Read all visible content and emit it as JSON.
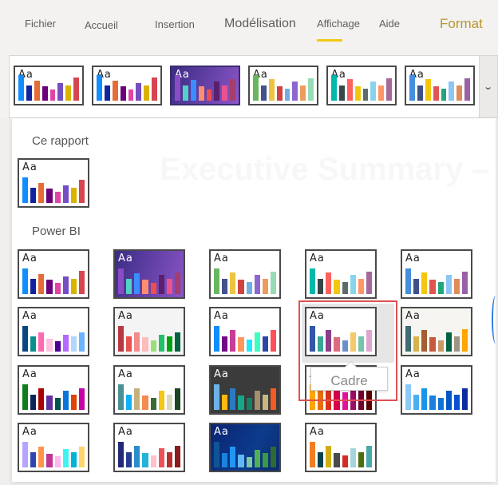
{
  "ribbon": {
    "tabs": [
      {
        "label": "Fichier"
      },
      {
        "label": "Accueil"
      },
      {
        "label": "Insertion"
      },
      {
        "label": "Modélisation"
      },
      {
        "label": "Affichage",
        "active": true
      },
      {
        "label": "Aide"
      },
      {
        "label": "Format",
        "contextual": true
      }
    ],
    "active_color": "#f2c811",
    "contextual_color": "#b8962e"
  },
  "thumb_label": "Aa",
  "gallery_expand_icon": "chevron-down-icon",
  "background_doc": {
    "title": "Executive Summary – Finance Report"
  },
  "sections": {
    "this_report": "Ce rapport",
    "power_bi": "Power BI"
  },
  "tooltip": "Cadre",
  "strip_themes": [
    {
      "bg": "#ffffff",
      "colors": [
        "#118dff",
        "#12239e",
        "#e66c37",
        "#6b007b",
        "#e044a7",
        "#744ec2",
        "#d9b300",
        "#d64550"
      ],
      "heights": [
        1,
        0.58,
        0.78,
        0.55,
        0.45,
        0.7,
        0.6,
        0.9
      ]
    },
    {
      "bg": "#ffffff",
      "colors": [
        "#118dff",
        "#12239e",
        "#e66c37",
        "#6b007b",
        "#e044a7",
        "#744ec2",
        "#d9b300",
        "#d64550"
      ],
      "heights": [
        1,
        0.58,
        0.78,
        0.55,
        0.45,
        0.7,
        0.6,
        0.9
      ]
    },
    {
      "bg": "linear-gradient(110deg,#3a2c84,#8c55c8)",
      "dark": true,
      "selected": true,
      "colors": [
        "#8a4cc4",
        "#52d1c5",
        "#3b8cff",
        "#ff8e6e",
        "#ee4d4d",
        "#5a1f6e",
        "#e9528d",
        "#a43e6e"
      ],
      "heights": [
        1,
        0.58,
        0.82,
        0.55,
        0.45,
        0.75,
        0.58,
        0.85
      ]
    },
    {
      "bg": "#ffffff",
      "colors": [
        "#6ab660",
        "#43518c",
        "#ecc440",
        "#cf4340",
        "#72aee3",
        "#8d67d0",
        "#ee9c5c",
        "#96dcb5"
      ],
      "heights": [
        1,
        0.58,
        0.85,
        0.55,
        0.48,
        0.75,
        0.58,
        0.88
      ]
    },
    {
      "bg": "#ffffff",
      "colors": [
        "#01b8aa",
        "#374649",
        "#fd625e",
        "#f2c80f",
        "#5f6b6d",
        "#8ad4eb",
        "#fe9666",
        "#a66999"
      ],
      "heights": [
        1,
        0.6,
        0.85,
        0.55,
        0.48,
        0.75,
        0.58,
        0.88
      ]
    },
    {
      "bg": "#ffffff",
      "colors": [
        "#468ede",
        "#3f5189",
        "#f4c70f",
        "#e05552",
        "#21a57a",
        "#8dc6f4",
        "#df8b5a",
        "#9a62a6"
      ],
      "heights": [
        1,
        0.6,
        0.85,
        0.55,
        0.48,
        0.75,
        0.58,
        0.88
      ]
    }
  ],
  "this_report_theme": {
    "bg": "#ffffff",
    "colors": [
      "#118dff",
      "#12239e",
      "#e66c37",
      "#6b007b",
      "#e044a7",
      "#744ec2",
      "#d9b300",
      "#d64550"
    ],
    "heights": [
      1,
      0.58,
      0.78,
      0.55,
      0.45,
      0.7,
      0.6,
      0.9
    ]
  },
  "power_bi_themes": [
    {
      "bg": "#ffffff",
      "colors": [
        "#118dff",
        "#12239e",
        "#e66c37",
        "#6b007b",
        "#e044a7",
        "#744ec2",
        "#d9b300",
        "#d64550"
      ],
      "heights": [
        1,
        0.58,
        0.78,
        0.55,
        0.45,
        0.7,
        0.6,
        0.9
      ]
    },
    {
      "bg": "linear-gradient(110deg,#3a2c84,#8c55c8)",
      "dark": true,
      "colors": [
        "#8a4cc4",
        "#52d1c5",
        "#3b8cff",
        "#ff8e6e",
        "#ee4d4d",
        "#5a1f6e",
        "#e9528d",
        "#a43e6e"
      ],
      "heights": [
        1,
        0.58,
        0.82,
        0.55,
        0.45,
        0.75,
        0.58,
        0.85
      ]
    },
    {
      "bg": "#ffffff",
      "colors": [
        "#6ab660",
        "#43518c",
        "#ecc440",
        "#cf4340",
        "#72aee3",
        "#8d67d0",
        "#ee9c5c",
        "#96dcb5"
      ],
      "heights": [
        1,
        0.58,
        0.85,
        0.55,
        0.48,
        0.75,
        0.58,
        0.88
      ]
    },
    {
      "bg": "#ffffff",
      "colors": [
        "#01b8aa",
        "#374649",
        "#fd625e",
        "#f2c80f",
        "#5f6b6d",
        "#8ad4eb",
        "#fe9666",
        "#a66999"
      ],
      "heights": [
        1,
        0.6,
        0.85,
        0.55,
        0.48,
        0.75,
        0.58,
        0.88
      ]
    },
    {
      "bg": "#ffffff",
      "colors": [
        "#468ede",
        "#3f5189",
        "#f4c70f",
        "#e05552",
        "#21a57a",
        "#8dc6f4",
        "#df8b5a",
        "#9a62a6"
      ],
      "heights": [
        1,
        0.6,
        0.85,
        0.55,
        0.48,
        0.75,
        0.58,
        0.88
      ]
    },
    {
      "bg": "#ffffff",
      "colors": [
        "#094780",
        "#0a8f8f",
        "#ff69b4",
        "#ffbfdf",
        "#4b0096",
        "#b469ff",
        "#afd7ff",
        "#6cb4ff"
      ],
      "heights": [
        1,
        0.6,
        0.75,
        0.5,
        0.4,
        0.65,
        0.6,
        0.75
      ]
    },
    {
      "bg": "#f4f4f4",
      "colors": [
        "#b83740",
        "#e8514d",
        "#f28b8a",
        "#fbbcbb",
        "#9be076",
        "#22c06d",
        "#00a30c",
        "#056340"
      ],
      "heights": [
        1,
        0.6,
        0.75,
        0.55,
        0.45,
        0.65,
        0.6,
        0.75
      ]
    },
    {
      "bg": "#ffffff",
      "colors": [
        "#118dff",
        "#750985",
        "#c83d95",
        "#ff985e",
        "#1de9ff",
        "#3bffc0",
        "#2d44a8",
        "#fe4f5b"
      ],
      "heights": [
        1,
        0.6,
        0.85,
        0.55,
        0.48,
        0.75,
        0.6,
        0.85
      ]
    },
    {
      "bg": "#ffffff",
      "hover": true,
      "name": "Cadre",
      "colors": [
        "#3257a8",
        "#37a794",
        "#8b3d88",
        "#dd6b7f",
        "#6b91c9",
        "#f5c869",
        "#77c4a8",
        "#dea6cf"
      ],
      "heights": [
        1,
        0.58,
        0.85,
        0.55,
        0.45,
        0.75,
        0.58,
        0.85
      ]
    },
    {
      "bg": "#f6f5f1",
      "colors": [
        "#3f6b74",
        "#d5b24a",
        "#a55d32",
        "#c75a3e",
        "#c9996a",
        "#056243",
        "#9f9484",
        "#ffa500"
      ],
      "heights": [
        1,
        0.58,
        0.85,
        0.55,
        0.45,
        0.75,
        0.6,
        0.88
      ]
    },
    {
      "bg": "#ffffff",
      "colors": [
        "#117d1c",
        "#0c2457",
        "#a70204",
        "#622fa0",
        "#005350",
        "#0c75dc",
        "#e14205",
        "#c403a7"
      ],
      "heights": [
        1,
        0.6,
        0.85,
        0.55,
        0.48,
        0.75,
        0.6,
        0.85
      ]
    },
    {
      "bg": "#ffffff",
      "colors": [
        "#4a8f94",
        "#12aff7",
        "#c6b07c",
        "#f38d4f",
        "#3a6b35",
        "#f5c614",
        "#dad8c1",
        "#1f4423"
      ],
      "heights": [
        1,
        0.6,
        0.85,
        0.55,
        0.48,
        0.75,
        0.6,
        0.85
      ]
    },
    {
      "bg": "#3b3b3b",
      "dark": true,
      "colors": [
        "#6db2e6",
        "#feb80e",
        "#2b7ac2",
        "#17a789",
        "#158066",
        "#a58e6b",
        "#c7b682",
        "#f45a24"
      ],
      "heights": [
        1,
        0.6,
        0.85,
        0.55,
        0.48,
        0.75,
        0.6,
        0.85
      ]
    },
    {
      "bg": "#ffffff",
      "colors": [
        "#ffa500",
        "#e86e0c",
        "#d8321d",
        "#d7004b",
        "#e0129a",
        "#9a0c66",
        "#6f0030",
        "#5a0000"
      ],
      "heights": [
        1,
        0.8,
        0.9,
        0.75,
        0.7,
        0.85,
        0.8,
        0.75
      ]
    },
    {
      "bg": "#ffffff",
      "colors": [
        "#8bc9f7",
        "#4aaef0",
        "#1894ea",
        "#1c7fdd",
        "#0e74d8",
        "#0059c7",
        "#0750d1",
        "#0a2d9f"
      ],
      "heights": [
        1,
        0.6,
        0.85,
        0.55,
        0.48,
        0.75,
        0.6,
        0.85
      ]
    },
    {
      "bg": "#ffffff",
      "colors": [
        "#b6a5ff",
        "#2f45b2",
        "#ff9549",
        "#c13592",
        "#ffb7ef",
        "#42f2f0",
        "#00b2d8",
        "#ffd56e"
      ],
      "heights": [
        1,
        0.6,
        0.8,
        0.52,
        0.45,
        0.72,
        0.6,
        0.8
      ]
    },
    {
      "bg": "#ffffff",
      "colors": [
        "#232877",
        "#233e93",
        "#2a8dca",
        "#24b3d6",
        "#ffc0cc",
        "#ed5257",
        "#b5312f",
        "#8c1a1d"
      ],
      "heights": [
        1,
        0.6,
        0.85,
        0.55,
        0.48,
        0.75,
        0.6,
        0.85
      ]
    },
    {
      "bg": "linear-gradient(120deg,#0a2472,#0d3b8c 60%,#0a2a6c)",
      "dark": true,
      "colors": [
        "#0f5596",
        "#1983dd",
        "#2196f3",
        "#60b8f7",
        "#7bc8a4",
        "#50b154",
        "#3a9945",
        "#2e6b33"
      ],
      "heights": [
        1,
        0.55,
        0.8,
        0.5,
        0.4,
        0.7,
        0.55,
        0.8
      ]
    },
    {
      "bg": "#ffffff",
      "colors": [
        "#f27e23",
        "#02444c",
        "#d0ad13",
        "#4a4a4a",
        "#d42b26",
        "#a6d4db",
        "#4d6e0f",
        "#4aa9ab"
      ],
      "heights": [
        1,
        0.6,
        0.85,
        0.55,
        0.48,
        0.75,
        0.6,
        0.85
      ]
    }
  ]
}
